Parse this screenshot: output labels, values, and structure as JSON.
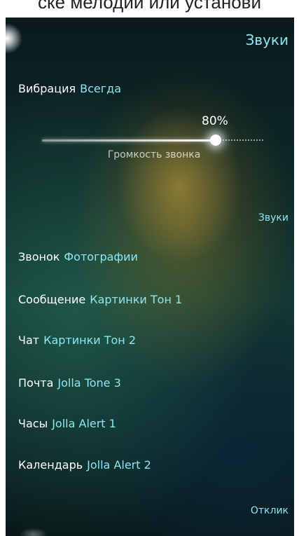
{
  "caption": "ске мелодии или установи",
  "header": {
    "title": "Звуки"
  },
  "vibration": {
    "label": "Вибрация",
    "value": "Всегда"
  },
  "volume": {
    "percent_label": "80%",
    "level": 0.8,
    "caption": "Громкость звонка"
  },
  "sounds_section": {
    "header": "Звуки"
  },
  "sound_items": [
    {
      "label": "Звонок",
      "value": "Фотографии"
    },
    {
      "label": "Сообщение",
      "value": "Картинки Тон 1"
    },
    {
      "label": "Чат",
      "value": "Картинки Тон 2"
    },
    {
      "label": "Почта",
      "value": "Jolla Tone 3"
    },
    {
      "label": "Часы",
      "value": "Jolla Alert 1"
    },
    {
      "label": "Календарь",
      "value": "Jolla Alert 2"
    }
  ],
  "feedback_section": {
    "header": "Отклик"
  },
  "colors": {
    "accent": "#8fe6f3",
    "text": "#ffffff"
  }
}
